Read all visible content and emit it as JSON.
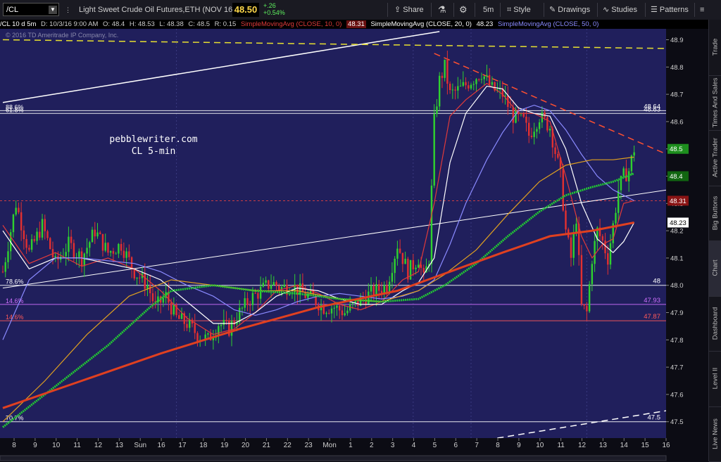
{
  "toolbar": {
    "symbol": "/CL",
    "description": "Light Sweet Crude Oil Futures,ETH (NOV 16)",
    "last_price": "48.50",
    "net_change": "+.26",
    "pct_change": "+0.54%",
    "share_label": "Share",
    "timeframe_label": "5m",
    "style_label": "Style",
    "drawings_label": "Drawings",
    "studies_label": "Studies",
    "patterns_label": "Patterns",
    "colors": {
      "price": "#ffd84a",
      "change": "#5ef05e"
    }
  },
  "infobar": {
    "symbol_period": "/CL 10 d 5m",
    "date": "D: 10/3/16 9:00 AM",
    "open": "O: 48.4",
    "high": "H: 48.53",
    "low": "L: 48.38",
    "close": "C: 48.5",
    "range": "R: 0.15",
    "sma10_label": "SimpleMovingAvg (CLOSE, 10, 0)",
    "sma10_value": "48.31",
    "sma20_label": "SimpleMovingAvg (CLOSE, 20, 0)",
    "sma20_value": "48.23",
    "sma50_label": "SimpleMovingAvg (CLOSE, 50, 0)",
    "colors": {
      "sma10": "#e03a3a",
      "sma20": "#ffffff",
      "sma50": "#8a8aff"
    }
  },
  "side_tabs": [
    "Trade",
    "Times And Sales",
    "Active Trader",
    "Big Buttons",
    "Chart",
    "Dashboard",
    "Level II",
    "Live News"
  ],
  "active_tab": "Chart",
  "chart_data": {
    "type": "candlestick",
    "copyright": "© 2016 TD Ameritrade IP Company, Inc.",
    "annotation": [
      "pebblewriter.com",
      "CL 5-min"
    ],
    "x_tick_labels": [
      "8",
      "9",
      "10",
      "11",
      "12",
      "13",
      "Sun",
      "16",
      "17",
      "18",
      "19",
      "20",
      "21",
      "22",
      "23",
      "Mon",
      "1",
      "2",
      "3",
      "4",
      "5",
      "6",
      "7",
      "8",
      "9",
      "10",
      "11",
      "12",
      "13",
      "14",
      "15",
      "16"
    ],
    "y_ticks": [
      47.5,
      47.6,
      47.7,
      47.8,
      47.9,
      48.0,
      48.1,
      48.2,
      48.3,
      48.4,
      48.5,
      48.6,
      48.7,
      48.8,
      48.9
    ],
    "ylim": [
      47.44,
      48.94
    ],
    "n_bars": 250,
    "horizontal_levels": [
      {
        "left_label": "88.6%",
        "price": 48.64,
        "label": "48.64",
        "color": "#ffffff"
      },
      {
        "left_label": "61.8%",
        "price": 48.63,
        "label": "48.63",
        "color": "#ffffff"
      },
      {
        "left_label": "78.6%",
        "price": 48.0,
        "label": "48",
        "color": "#ffffff"
      },
      {
        "left_label": "14.6%",
        "price": 47.93,
        "label": "47.93",
        "color": "#d070ff"
      },
      {
        "left_label": "14.6%",
        "price": 47.87,
        "label": "47.87",
        "color": "#ff5a5a"
      },
      {
        "left_label": "70.7%",
        "price": 47.5,
        "label": "47.5",
        "color": "#ffffff"
      },
      {
        "left_label": "",
        "price": 48.31,
        "label": "",
        "color": "#e04040"
      }
    ],
    "axis_price_tags": [
      {
        "price": 48.5,
        "label": "48.5",
        "bg": "#1e8f1e",
        "fg": "#ffffff"
      },
      {
        "price": 48.4,
        "label": "48.4",
        "bg": "#116611",
        "fg": "#ffffff"
      },
      {
        "price": 48.31,
        "label": "48.31",
        "bg": "#8a1414",
        "fg": "#ffffff"
      },
      {
        "price": 48.23,
        "label": "48.23",
        "bg": "#ffffff",
        "fg": "#000000"
      }
    ],
    "trendlines": [
      {
        "name": "upper-white",
        "from": [
          0,
          48.67
        ],
        "to": [
          166,
          48.93
        ],
        "color": "#ffffff",
        "dash": false,
        "width": 1.5
      },
      {
        "name": "yellow-dashed",
        "from": [
          0,
          48.9
        ],
        "to": [
          316,
          48.86
        ],
        "color": "#e8e030",
        "dash": true,
        "width": 1.5
      },
      {
        "name": "red-dashed",
        "from": [
          164,
          48.85
        ],
        "to": [
          262,
          48.44
        ],
        "color": "#ff5030",
        "dash": true,
        "width": 1.5
      },
      {
        "name": "mid-white",
        "from": [
          0,
          47.99
        ],
        "to": [
          316,
          48.44
        ],
        "color": "#ffffff",
        "dash": false,
        "width": 1
      },
      {
        "name": "lower-white-dashed",
        "from": [
          188,
          47.44
        ],
        "to": [
          316,
          47.64
        ],
        "color": "#ffffff",
        "dash": true,
        "width": 1.5
      }
    ],
    "sma_series": [
      {
        "name": "sma10",
        "color": "#e03a3a",
        "points": [
          [
            0,
            48.22
          ],
          [
            10,
            48.08
          ],
          [
            20,
            48.12
          ],
          [
            30,
            48.07
          ],
          [
            40,
            48.1
          ],
          [
            50,
            48.06
          ],
          [
            60,
            47.98
          ],
          [
            70,
            47.88
          ],
          [
            80,
            47.82
          ],
          [
            88,
            47.84
          ],
          [
            96,
            47.9
          ],
          [
            104,
            47.98
          ],
          [
            112,
            48.0
          ],
          [
            120,
            47.97
          ],
          [
            128,
            47.93
          ],
          [
            136,
            47.91
          ],
          [
            144,
            47.94
          ],
          [
            152,
            48.02
          ],
          [
            158,
            48.05
          ],
          [
            164,
            48.3
          ],
          [
            170,
            48.62
          ],
          [
            176,
            48.68
          ],
          [
            184,
            48.74
          ],
          [
            190,
            48.7
          ],
          [
            196,
            48.63
          ],
          [
            202,
            48.63
          ],
          [
            208,
            48.6
          ],
          [
            214,
            48.4
          ],
          [
            220,
            48.18
          ],
          [
            224,
            48.1
          ],
          [
            228,
            48.15
          ],
          [
            232,
            48.17
          ],
          [
            236,
            48.3
          ],
          [
            240,
            48.31
          ]
        ]
      },
      {
        "name": "sma20",
        "color": "#ffffff",
        "points": [
          [
            0,
            48.2
          ],
          [
            10,
            48.06
          ],
          [
            20,
            48.1
          ],
          [
            30,
            48.1
          ],
          [
            40,
            48.08
          ],
          [
            50,
            48.06
          ],
          [
            60,
            48.02
          ],
          [
            70,
            47.94
          ],
          [
            80,
            47.86
          ],
          [
            88,
            47.86
          ],
          [
            96,
            47.9
          ],
          [
            104,
            47.96
          ],
          [
            112,
            47.99
          ],
          [
            120,
            47.98
          ],
          [
            128,
            47.95
          ],
          [
            136,
            47.93
          ],
          [
            144,
            47.93
          ],
          [
            152,
            47.98
          ],
          [
            158,
            48.01
          ],
          [
            164,
            48.1
          ],
          [
            170,
            48.45
          ],
          [
            176,
            48.63
          ],
          [
            184,
            48.73
          ],
          [
            190,
            48.72
          ],
          [
            196,
            48.65
          ],
          [
            202,
            48.63
          ],
          [
            208,
            48.62
          ],
          [
            214,
            48.5
          ],
          [
            220,
            48.3
          ],
          [
            226,
            48.17
          ],
          [
            232,
            48.12
          ],
          [
            236,
            48.16
          ],
          [
            240,
            48.23
          ]
        ]
      },
      {
        "name": "sma50",
        "color": "#8a8aff",
        "points": [
          [
            0,
            47.8
          ],
          [
            10,
            48.02
          ],
          [
            20,
            48.1
          ],
          [
            30,
            48.1
          ],
          [
            40,
            48.09
          ],
          [
            50,
            48.08
          ],
          [
            60,
            48.05
          ],
          [
            70,
            48.0
          ],
          [
            80,
            47.96
          ],
          [
            88,
            47.91
          ],
          [
            96,
            47.89
          ],
          [
            104,
            47.91
          ],
          [
            112,
            47.94
          ],
          [
            120,
            47.96
          ],
          [
            128,
            47.97
          ],
          [
            136,
            47.96
          ],
          [
            144,
            47.95
          ],
          [
            152,
            47.96
          ],
          [
            158,
            47.98
          ],
          [
            164,
            48.02
          ],
          [
            170,
            48.15
          ],
          [
            176,
            48.3
          ],
          [
            184,
            48.46
          ],
          [
            190,
            48.56
          ],
          [
            196,
            48.64
          ],
          [
            202,
            48.66
          ],
          [
            208,
            48.64
          ],
          [
            214,
            48.57
          ],
          [
            220,
            48.48
          ],
          [
            226,
            48.4
          ],
          [
            232,
            48.35
          ],
          [
            236,
            48.33
          ],
          [
            240,
            48.31
          ]
        ]
      },
      {
        "name": "sma_orange",
        "color": "#e0a020",
        "points": [
          [
            0,
            47.5
          ],
          [
            16,
            47.65
          ],
          [
            32,
            47.82
          ],
          [
            48,
            47.96
          ],
          [
            64,
            48.02
          ],
          [
            80,
            48.0
          ],
          [
            96,
            47.98
          ],
          [
            112,
            47.98
          ],
          [
            128,
            47.95
          ],
          [
            144,
            47.94
          ],
          [
            158,
            47.98
          ],
          [
            168,
            48.04
          ],
          [
            180,
            48.13
          ],
          [
            192,
            48.26
          ],
          [
            204,
            48.38
          ],
          [
            214,
            48.44
          ],
          [
            224,
            48.46
          ],
          [
            232,
            48.46
          ],
          [
            240,
            48.47
          ]
        ]
      },
      {
        "name": "sma_green",
        "color": "#22cc33",
        "points": [
          [
            0,
            47.48
          ],
          [
            20,
            47.63
          ],
          [
            40,
            47.78
          ],
          [
            56,
            47.92
          ],
          [
            64,
            47.98
          ],
          [
            80,
            48.0
          ],
          [
            96,
            47.98
          ],
          [
            112,
            47.97
          ],
          [
            128,
            47.95
          ],
          [
            144,
            47.94
          ],
          [
            158,
            47.95
          ],
          [
            168,
            48.0
          ],
          [
            180,
            48.08
          ],
          [
            192,
            48.18
          ],
          [
            204,
            48.27
          ],
          [
            214,
            48.33
          ],
          [
            224,
            48.36
          ],
          [
            232,
            48.38
          ],
          [
            240,
            48.41
          ]
        ]
      },
      {
        "name": "sma_redthick",
        "color": "#e04020",
        "points": [
          [
            0,
            47.55
          ],
          [
            30,
            47.65
          ],
          [
            60,
            47.75
          ],
          [
            90,
            47.84
          ],
          [
            120,
            47.92
          ],
          [
            150,
            47.98
          ],
          [
            170,
            48.05
          ],
          [
            190,
            48.12
          ],
          [
            208,
            48.18
          ],
          [
            224,
            48.2
          ],
          [
            240,
            48.23
          ]
        ]
      }
    ],
    "price_path": [
      [
        0,
        48.05
      ],
      [
        5,
        48.3
      ],
      [
        10,
        48.12
      ],
      [
        15,
        48.22
      ],
      [
        20,
        48.08
      ],
      [
        25,
        48.15
      ],
      [
        30,
        48.1
      ],
      [
        35,
        48.2
      ],
      [
        40,
        48.12
      ],
      [
        45,
        48.15
      ],
      [
        50,
        48.05
      ],
      [
        55,
        48.0
      ],
      [
        58,
        47.92
      ],
      [
        62,
        47.96
      ],
      [
        66,
        47.88
      ],
      [
        70,
        47.86
      ],
      [
        74,
        47.82
      ],
      [
        78,
        47.8
      ],
      [
        82,
        47.86
      ],
      [
        86,
        47.84
      ],
      [
        90,
        47.9
      ],
      [
        94,
        47.95
      ],
      [
        98,
        47.98
      ],
      [
        102,
        48.01
      ],
      [
        106,
        47.99
      ],
      [
        110,
        48.0
      ],
      [
        114,
        47.97
      ],
      [
        118,
        47.95
      ],
      [
        122,
        47.92
      ],
      [
        126,
        47.92
      ],
      [
        130,
        47.9
      ],
      [
        134,
        47.93
      ],
      [
        138,
        47.96
      ],
      [
        142,
        47.98
      ],
      [
        146,
        48.0
      ],
      [
        150,
        48.15
      ],
      [
        154,
        48.05
      ],
      [
        158,
        48.1
      ],
      [
        160,
        48.02
      ],
      [
        162,
        48.1
      ],
      [
        164,
        48.6
      ],
      [
        166,
        48.75
      ],
      [
        168,
        48.8
      ],
      [
        170,
        48.7
      ],
      [
        174,
        48.72
      ],
      [
        178,
        48.75
      ],
      [
        182,
        48.78
      ],
      [
        186,
        48.72
      ],
      [
        190,
        48.7
      ],
      [
        194,
        48.62
      ],
      [
        198,
        48.6
      ],
      [
        200,
        48.55
      ],
      [
        204,
        48.62
      ],
      [
        208,
        48.58
      ],
      [
        212,
        48.4
      ],
      [
        214,
        48.2
      ],
      [
        216,
        48.1
      ],
      [
        218,
        48.25
      ],
      [
        220,
        47.92
      ],
      [
        222,
        47.9
      ],
      [
        224,
        48.1
      ],
      [
        226,
        48.2
      ],
      [
        228,
        48.16
      ],
      [
        230,
        48.1
      ],
      [
        232,
        48.22
      ],
      [
        234,
        48.35
      ],
      [
        236,
        48.4
      ],
      [
        238,
        48.42
      ],
      [
        240,
        48.5
      ]
    ]
  }
}
